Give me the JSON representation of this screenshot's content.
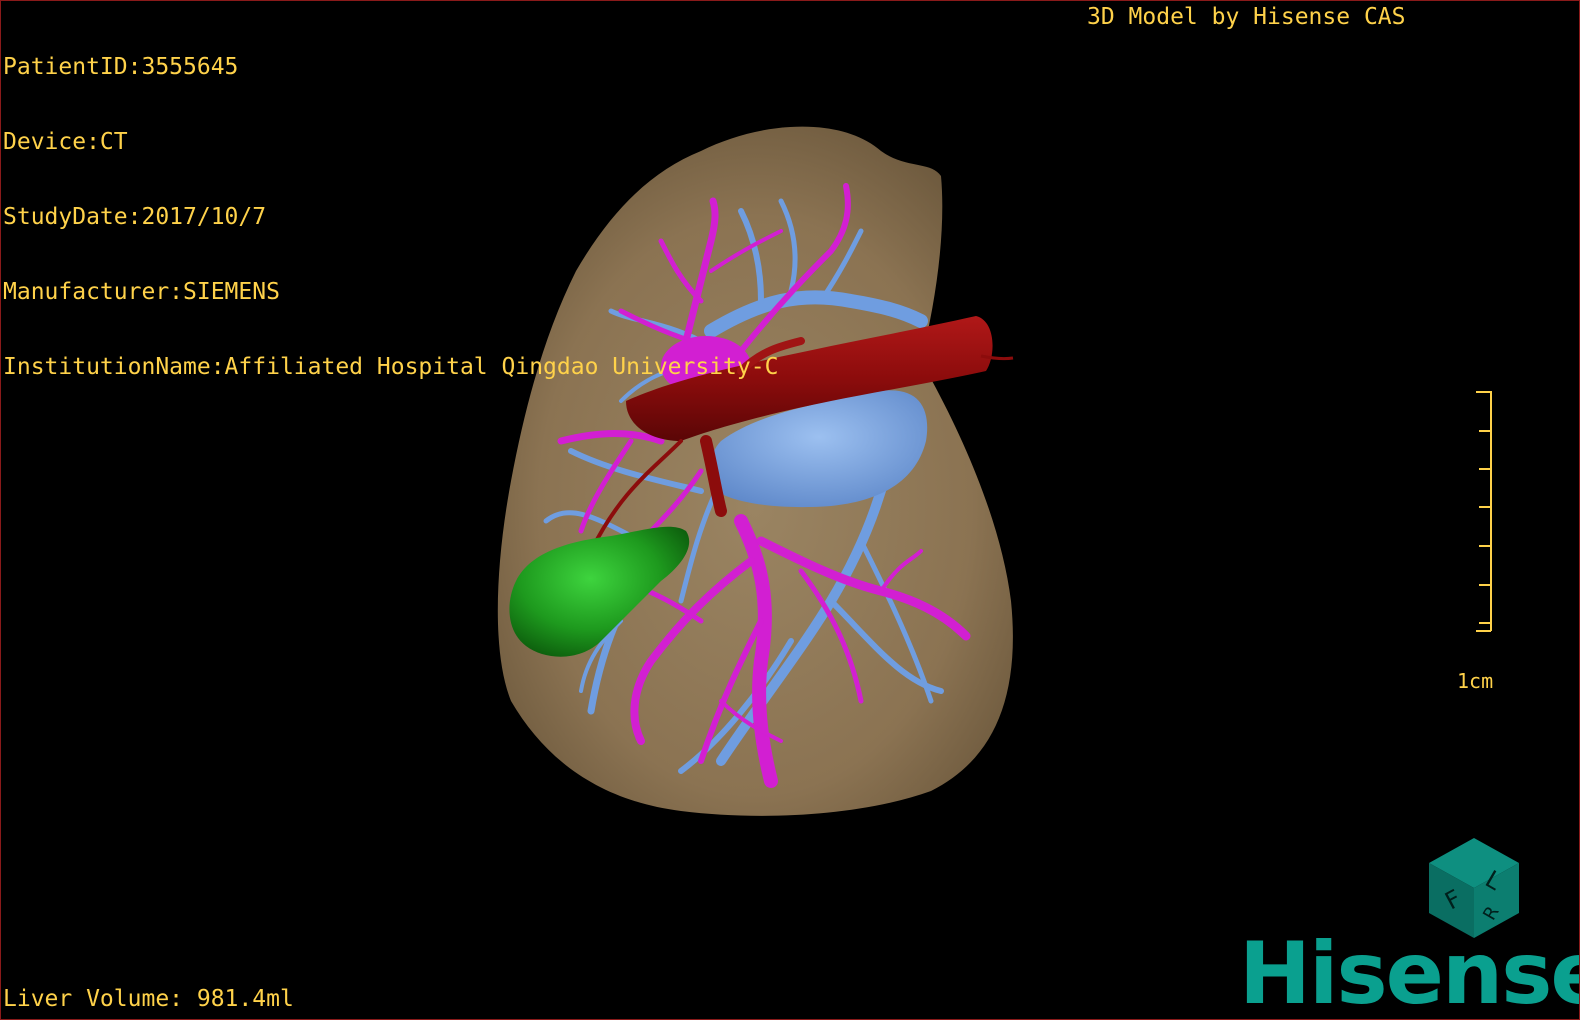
{
  "patient_info": {
    "patient_id": "PatientID:3555645",
    "device": "Device:CT",
    "study_date": "StudyDate:2017/10/7",
    "manufacturer": "Manufacturer:SIEMENS",
    "institution": "InstitutionName:Affiliated Hospital Qingdao University-C"
  },
  "viewer": {
    "title": "3D Model by Hisense CAS",
    "liver_volume": "Liver Volume: 981.4ml",
    "scale_label": "1cm",
    "brand": "Hisense"
  },
  "orientation_cube": {
    "labels": [
      "F",
      "L",
      "R"
    ]
  },
  "colors": {
    "overlay_text": "#ffd24a",
    "liver": "#8b7352",
    "portal_vein": "#d21fd2",
    "hepatic_vein": "#6f9de0",
    "vena_cava": "#8c0c0c",
    "gallbladder": "#1e9a1e",
    "brand": "#0aa08f"
  }
}
